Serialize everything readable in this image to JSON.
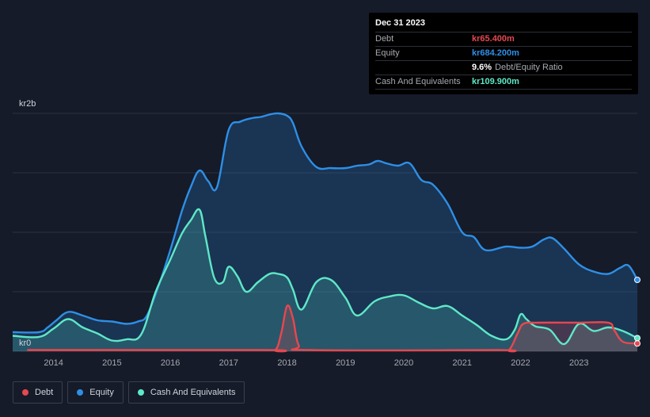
{
  "tooltip": {
    "date": "Dec 31 2023",
    "debt_label": "Debt",
    "debt_value": "kr65.400m",
    "equity_label": "Equity",
    "equity_value": "kr684.200m",
    "ratio_value": "9.6%",
    "ratio_label": "Debt/Equity Ratio",
    "cash_label": "Cash And Equivalents",
    "cash_value": "kr109.900m"
  },
  "legend": [
    {
      "label": "Debt",
      "color": "#e8474f"
    },
    {
      "label": "Equity",
      "color": "#2e8fe6"
    },
    {
      "label": "Cash And Equivalents",
      "color": "#5ee8c8"
    }
  ],
  "colors": {
    "debt": "#e8474f",
    "equity": "#2e8fe6",
    "cash": "#5ee8c8",
    "background": "#151b29"
  },
  "chart_data": {
    "type": "area",
    "xlim": [
      2013.3,
      2024.0
    ],
    "ylim": [
      0,
      2
    ],
    "y_unit": "bn kr",
    "y_ticks": [
      {
        "value": 0,
        "label": "kr0"
      },
      {
        "value": 2,
        "label": "kr2b"
      }
    ],
    "x_ticks": [
      "2014",
      "2015",
      "2016",
      "2017",
      "2018",
      "2019",
      "2020",
      "2021",
      "2022",
      "2023"
    ],
    "grid": true,
    "series": [
      {
        "name": "Equity",
        "key": "equity",
        "x": [
          2013.3,
          2013.75,
          2013.9,
          2014.05,
          2014.25,
          2014.5,
          2014.75,
          2015.0,
          2015.25,
          2015.45,
          2015.6,
          2015.8,
          2016.0,
          2016.2,
          2016.35,
          2016.5,
          2016.65,
          2016.8,
          2017.0,
          2017.2,
          2017.4,
          2017.55,
          2017.7,
          2017.85,
          2018.0,
          2018.1,
          2018.25,
          2018.5,
          2018.75,
          2019.0,
          2019.2,
          2019.4,
          2019.55,
          2019.7,
          2019.9,
          2020.1,
          2020.3,
          2020.5,
          2020.75,
          2021.0,
          2021.2,
          2021.4,
          2021.75,
          2022.0,
          2022.2,
          2022.4,
          2022.55,
          2022.75,
          2023.0,
          2023.25,
          2023.5,
          2023.7,
          2023.85,
          2024.0
        ],
        "values": [
          0.16,
          0.16,
          0.2,
          0.26,
          0.33,
          0.3,
          0.26,
          0.25,
          0.23,
          0.25,
          0.3,
          0.55,
          0.85,
          1.18,
          1.38,
          1.52,
          1.43,
          1.38,
          1.86,
          1.93,
          1.96,
          1.97,
          1.99,
          2.0,
          1.98,
          1.92,
          1.72,
          1.55,
          1.54,
          1.54,
          1.56,
          1.57,
          1.6,
          1.58,
          1.56,
          1.58,
          1.44,
          1.4,
          1.24,
          1.0,
          0.96,
          0.85,
          0.88,
          0.87,
          0.88,
          0.94,
          0.95,
          0.86,
          0.73,
          0.67,
          0.65,
          0.7,
          0.72,
          0.6
        ]
      },
      {
        "name": "Cash And Equivalents",
        "key": "cash",
        "x": [
          2013.3,
          2013.75,
          2014.0,
          2014.25,
          2014.5,
          2014.75,
          2015.0,
          2015.25,
          2015.5,
          2015.75,
          2016.0,
          2016.2,
          2016.35,
          2016.5,
          2016.6,
          2016.75,
          2016.9,
          2017.0,
          2017.15,
          2017.3,
          2017.5,
          2017.7,
          2017.85,
          2018.0,
          2018.1,
          2018.25,
          2018.5,
          2018.75,
          2019.0,
          2019.2,
          2019.5,
          2019.75,
          2020.0,
          2020.25,
          2020.5,
          2020.75,
          2021.0,
          2021.25,
          2021.5,
          2021.75,
          2021.9,
          2022.0,
          2022.1,
          2022.25,
          2022.5,
          2022.75,
          2023.0,
          2023.25,
          2023.5,
          2023.75,
          2024.0
        ],
        "values": [
          0.13,
          0.12,
          0.19,
          0.27,
          0.2,
          0.15,
          0.09,
          0.1,
          0.14,
          0.5,
          0.77,
          0.99,
          1.1,
          1.19,
          0.97,
          0.62,
          0.58,
          0.71,
          0.63,
          0.5,
          0.58,
          0.65,
          0.65,
          0.62,
          0.52,
          0.35,
          0.58,
          0.6,
          0.45,
          0.3,
          0.42,
          0.46,
          0.47,
          0.41,
          0.36,
          0.38,
          0.3,
          0.22,
          0.13,
          0.1,
          0.18,
          0.31,
          0.27,
          0.21,
          0.18,
          0.06,
          0.23,
          0.17,
          0.2,
          0.17,
          0.11
        ]
      },
      {
        "name": "Debt",
        "key": "debt",
        "x": [
          2013.3,
          2013.55,
          2017.6,
          2017.8,
          2017.9,
          2018.0,
          2018.1,
          2018.2,
          2018.4,
          2021.6,
          2021.8,
          2021.95,
          2022.05,
          2022.3,
          2023.0,
          2023.5,
          2023.6,
          2023.75,
          2024.0
        ],
        "values": [
          null,
          0.01,
          0.01,
          0.01,
          0.15,
          0.38,
          0.28,
          0.05,
          0.01,
          0.01,
          0.01,
          0.15,
          0.23,
          0.24,
          0.24,
          0.24,
          0.18,
          0.08,
          0.065
        ]
      }
    ]
  }
}
